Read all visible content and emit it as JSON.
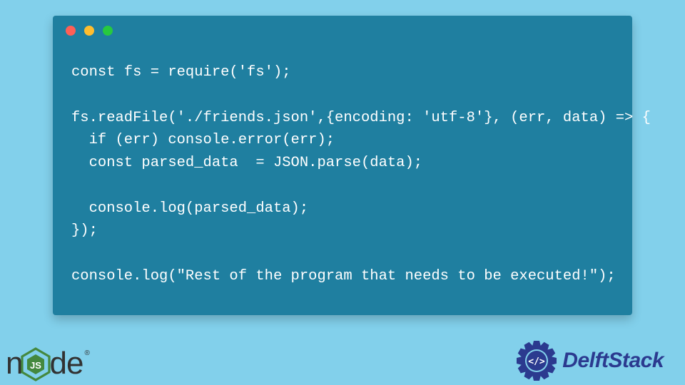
{
  "code": {
    "lines": [
      "const fs = require('fs');",
      "",
      "fs.readFile('./friends.json',{encoding: 'utf-8'}, (err, data) => {",
      "  if (err) console.error(err);",
      "  const parsed_data  = JSON.parse(data);",
      "",
      "  console.log(parsed_data);",
      "});",
      "",
      "console.log(\"Rest of the program that needs to be executed!\");"
    ]
  },
  "traffic_lights": {
    "red": "#ff5f56",
    "yellow": "#ffbd2e",
    "green": "#27c93f"
  },
  "logos": {
    "node_text_left": "n",
    "node_text_right": "de",
    "node_sub": "JS",
    "delftstack": "DelftStack"
  },
  "colors": {
    "bg": "#82d0eb",
    "window": "#1f7fa0",
    "code_text": "#ffffff",
    "node_green": "#44883e",
    "delft_blue": "#2b3a8f"
  }
}
